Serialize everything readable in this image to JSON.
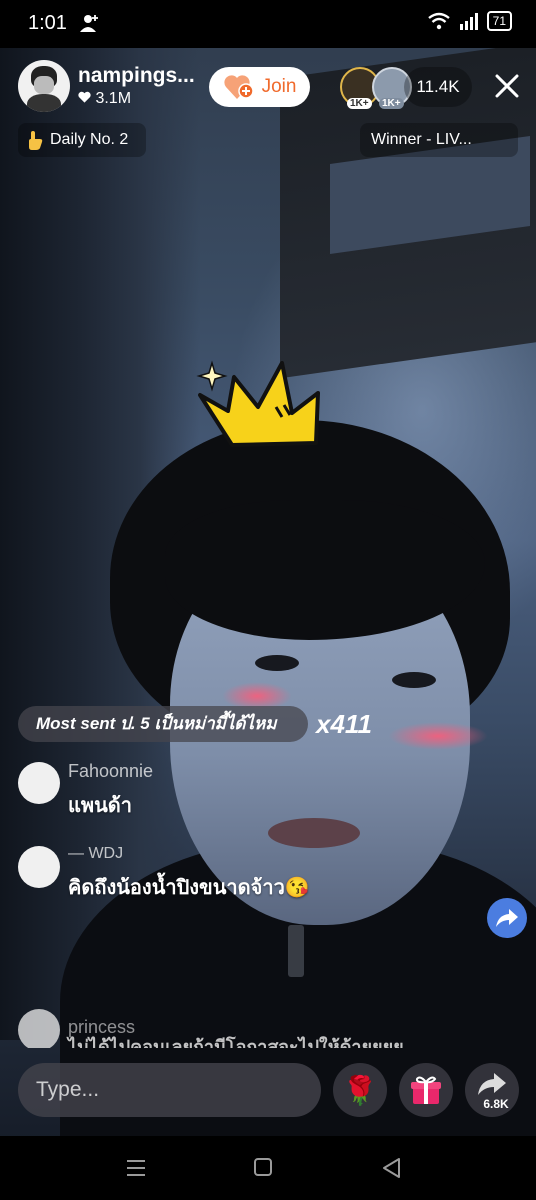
{
  "status_bar": {
    "time": "1:01",
    "battery": "71"
  },
  "host": {
    "name": "nampings...",
    "likes": "3.1M"
  },
  "join_button": {
    "label": "Join"
  },
  "viewers": {
    "count": "11.4K",
    "badges": [
      "1K+",
      "1K+"
    ]
  },
  "chips": {
    "daily_rank": "Daily No. 2",
    "winner": "Winner - LIV..."
  },
  "gift_banner": {
    "text": "Most sent ป. 5 เป็นหม่ามี้ได้ไหม",
    "multiplier": "x411"
  },
  "comments": [
    {
      "user": "Fahoonnie",
      "text": "แพนด้า"
    },
    {
      "user": "— WDJ",
      "text": "คิดถึงน้องน้ำปิงขนาดจ้าว😘"
    },
    {
      "user": "princess",
      "text": "ไม่ได้ไปคอนเลยถ้ามีโอกาสจะไปให้ด้ายยยย"
    }
  ],
  "composer": {
    "placeholder": "Type..."
  },
  "actions": {
    "share_count": "6.8K",
    "rose_emoji": "🌹"
  },
  "icons": {
    "add_person": "add-person-icon",
    "wifi": "wifi-icon",
    "signal": "signal-icon",
    "heart": "heart-icon",
    "crown": "crown-icon",
    "gift": "gift-icon",
    "share": "share-arrow-icon",
    "close": "close-icon"
  },
  "colors": {
    "join_accent": "#f06a2c",
    "share_blue": "#4b7de0",
    "gift_pink": "#e9286b"
  }
}
